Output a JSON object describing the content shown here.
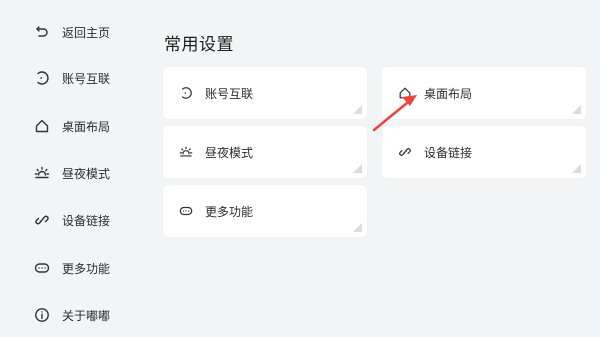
{
  "sidebar": {
    "items": [
      {
        "label": "返回主页",
        "icon": "back-arrow-icon"
      },
      {
        "label": "账号互联",
        "icon": "account-link-icon"
      },
      {
        "label": "桌面布局",
        "icon": "home-icon"
      },
      {
        "label": "昼夜模式",
        "icon": "sun-icon"
      },
      {
        "label": "设备链接",
        "icon": "link-icon"
      },
      {
        "label": "更多功能",
        "icon": "more-icon"
      },
      {
        "label": "关于嘟嘟",
        "icon": "info-icon"
      }
    ]
  },
  "main": {
    "title": "常用设置",
    "cards": [
      {
        "label": "账号互联",
        "icon": "account-link-icon"
      },
      {
        "label": "桌面布局",
        "icon": "home-icon"
      },
      {
        "label": "昼夜模式",
        "icon": "sun-icon"
      },
      {
        "label": "设备链接",
        "icon": "link-icon"
      },
      {
        "label": "更多功能",
        "icon": "more-icon"
      }
    ]
  },
  "annotation": {
    "arrow_color": "#e8453c"
  }
}
